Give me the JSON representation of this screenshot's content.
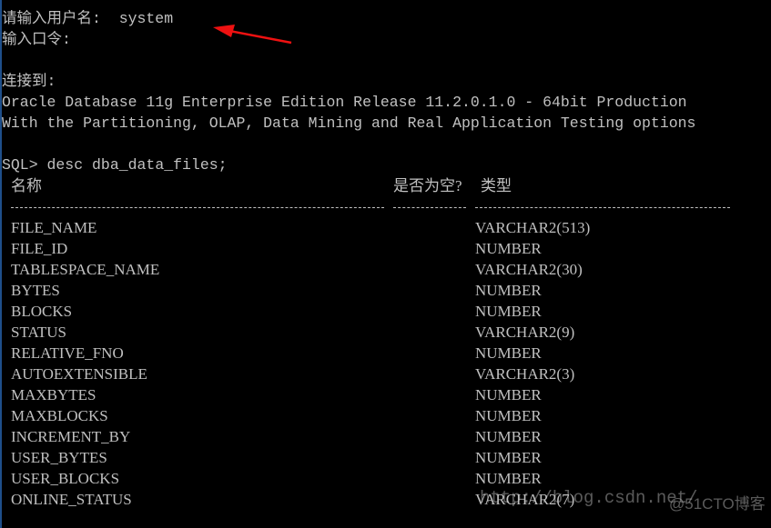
{
  "terminal": {
    "lines": [
      "请输入用户名:  system",
      "输入口令:",
      "",
      "连接到:",
      "Oracle Database 11g Enterprise Edition Release 11.2.0.1.0 - 64bit Production",
      "With the Partitioning, OLAP, Data Mining and Real Application Testing options",
      "",
      "SQL> desc dba_data_files;"
    ],
    "table": {
      "headers": [
        "名称",
        "是否为空?",
        "类型"
      ],
      "rows": [
        {
          "name": "FILE_NAME",
          "type": "VARCHAR2(513)"
        },
        {
          "name": "FILE_ID",
          "type": "NUMBER"
        },
        {
          "name": "TABLESPACE_NAME",
          "type": "VARCHAR2(30)"
        },
        {
          "name": "BYTES",
          "type": "NUMBER"
        },
        {
          "name": "BLOCKS",
          "type": "NUMBER"
        },
        {
          "name": "STATUS",
          "type": "VARCHAR2(9)"
        },
        {
          "name": "RELATIVE_FNO",
          "type": "NUMBER"
        },
        {
          "name": "AUTOEXTENSIBLE",
          "type": "VARCHAR2(3)"
        },
        {
          "name": "MAXBYTES",
          "type": "NUMBER"
        },
        {
          "name": "MAXBLOCKS",
          "type": "NUMBER"
        },
        {
          "name": "INCREMENT_BY",
          "type": "NUMBER"
        },
        {
          "name": "USER_BYTES",
          "type": "NUMBER"
        },
        {
          "name": "USER_BLOCKS",
          "type": "NUMBER"
        },
        {
          "name": "ONLINE_STATUS",
          "type": "VARCHAR2(7)"
        }
      ]
    }
  },
  "watermark": {
    "url": "http://blog.csdn.net/",
    "site": "@51CTO博客"
  },
  "colors": {
    "background": "#000000",
    "text": "#c0c0c0",
    "arrow": "#ee1111"
  },
  "annotation": {
    "icon": "red-arrow-icon"
  }
}
